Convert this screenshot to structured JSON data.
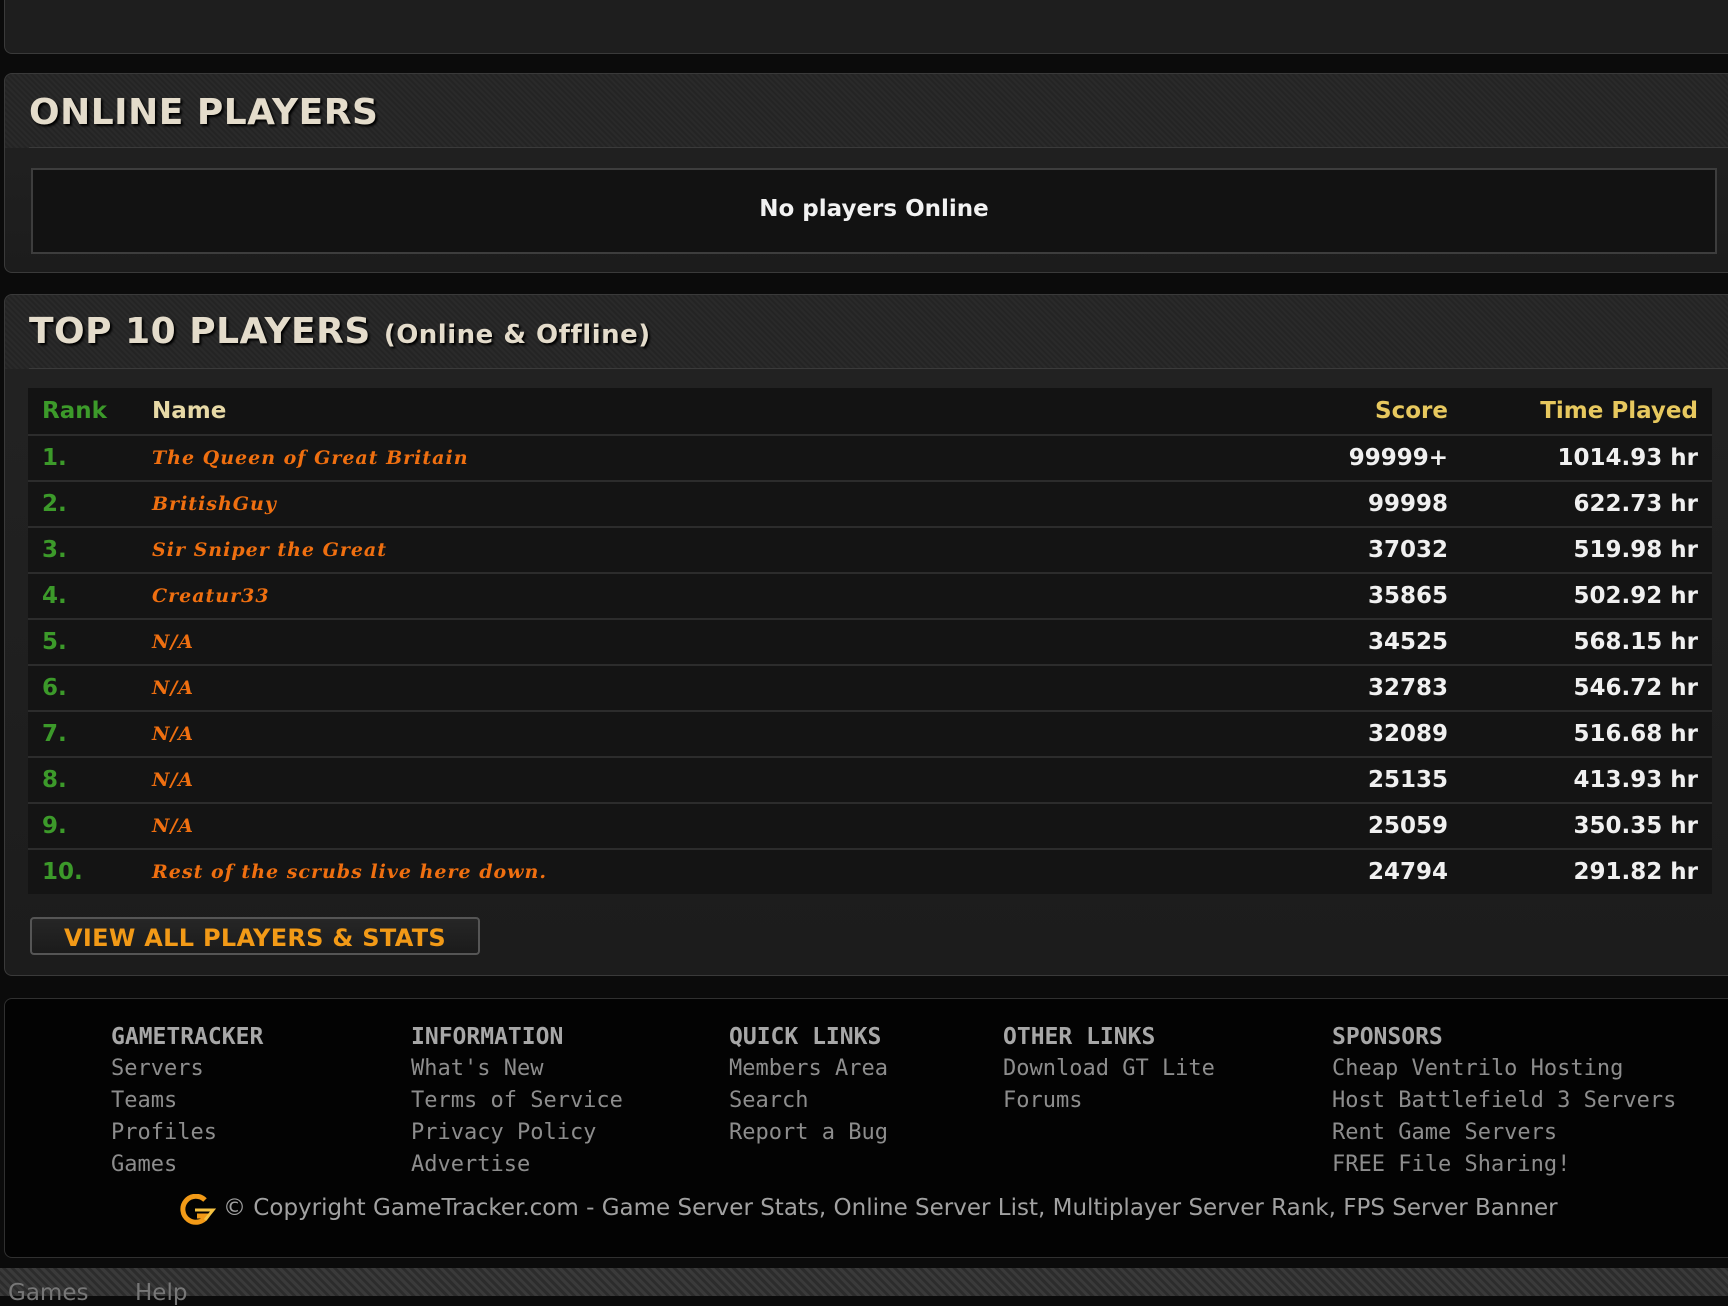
{
  "online_players": {
    "title": "ONLINE PLAYERS",
    "message": "No players Online"
  },
  "top_players": {
    "title": "TOP 10 PLAYERS",
    "subtitle": "(Online & Offline)",
    "headers": {
      "rank": "Rank",
      "name": "Name",
      "score": "Score",
      "time": "Time Played"
    },
    "rows": [
      {
        "rank": "1.",
        "name": "The Queen of Great Britain",
        "score": "99999+",
        "time": "1014.93 hr"
      },
      {
        "rank": "2.",
        "name": "BritishGuy",
        "score": "99998",
        "time": "622.73 hr"
      },
      {
        "rank": "3.",
        "name": "Sir Sniper the Great",
        "score": "37032",
        "time": "519.98 hr"
      },
      {
        "rank": "4.",
        "name": "Creatur33",
        "score": "35865",
        "time": "502.92 hr"
      },
      {
        "rank": "5.",
        "name": "N/A",
        "score": "34525",
        "time": "568.15 hr"
      },
      {
        "rank": "6.",
        "name": "N/A",
        "score": "32783",
        "time": "546.72 hr"
      },
      {
        "rank": "7.",
        "name": "N/A",
        "score": "32089",
        "time": "516.68 hr"
      },
      {
        "rank": "8.",
        "name": "N/A",
        "score": "25135",
        "time": "413.93 hr"
      },
      {
        "rank": "9.",
        "name": "N/A",
        "score": "25059",
        "time": "350.35 hr"
      },
      {
        "rank": "10.",
        "name": "Rest of the scrubs live here down.",
        "score": "24794",
        "time": "291.82 hr"
      }
    ],
    "view_all_label": "VIEW ALL PLAYERS & STATS"
  },
  "footer": {
    "columns": [
      {
        "title": "GAMETRACKER",
        "links": [
          "Servers",
          "Teams",
          "Profiles",
          "Games"
        ]
      },
      {
        "title": "INFORMATION",
        "links": [
          "What's New",
          "Terms of Service",
          "Privacy Policy",
          "Advertise"
        ]
      },
      {
        "title": "QUICK LINKS",
        "links": [
          "Members Area",
          "Search",
          "Report a Bug"
        ]
      },
      {
        "title": "OTHER LINKS",
        "links": [
          "Download GT Lite",
          "Forums"
        ]
      },
      {
        "title": "SPONSORS",
        "links": [
          "Cheap Ventrilo Hosting",
          "Host Battlefield 3 Servers",
          "Rent Game Servers",
          "FREE File Sharing!"
        ]
      }
    ],
    "copyright": "© Copyright GameTracker.com - Game Server Stats, Online Server List, Multiplayer Server Rank, FPS Server Banner"
  },
  "bottom_bar": {
    "links": [
      "Games",
      "Help"
    ]
  },
  "colors": {
    "rank_green": "#3c9a2a",
    "name_orange": "#ef6f10",
    "button_orange": "#f29a17",
    "header_gold": "#e7c85e"
  }
}
